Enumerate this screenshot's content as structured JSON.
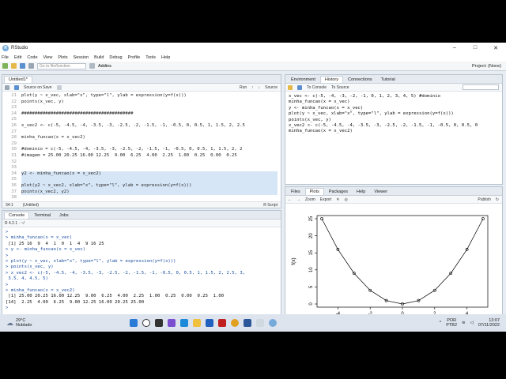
{
  "window": {
    "title": "RStudio",
    "app_icon": "R"
  },
  "menu": [
    "File",
    "Edit",
    "Code",
    "View",
    "Plots",
    "Session",
    "Build",
    "Debug",
    "Profile",
    "Tools",
    "Help"
  ],
  "toolbar": {
    "goto_placeholder": "Go to file/function",
    "addins": "Addins",
    "project": "Project: (None)"
  },
  "source": {
    "tab": "Untitled1*",
    "save_label": "Source on Save",
    "run_label": "Run",
    "source_label": "Source",
    "line_numbers": [
      "21",
      "22",
      "23",
      "24",
      "25",
      "26",
      "27",
      "28",
      "29",
      "30",
      "31",
      "32",
      "33",
      "34",
      "35",
      "36",
      "37",
      "38",
      "39",
      "40"
    ],
    "lines": [
      "plot(y ~ x_vec, xlab=\"x\", type=\"l\", ylab = expression(y=f(x)))",
      "points(x_vec, y)",
      "",
      "##########################################",
      "",
      "x_vec2 <- c(-5, -4.5, -4, -3.5, -3, -2.5, -2, -1.5, -1, -0.5, 0, 0.5, 1, 1.5, 2, 2.5",
      "",
      "minha_funcao(x = x_vec2)",
      "",
      "#dominio = c(-5, -4.5, -4, -3.5, -3, -2.5, -2, -1.5, -1, -0.5, 0, 0.5, 1, 1.5, 2, 2",
      "#imagem = 25.00 20.25 16.00 12.25  9.00  6.25  4.00  2.25  1.00  0.25  0.00  0.25",
      "",
      "",
      "y2 <- minha_funcao(x = x_vec2)",
      "",
      "plot(y2 ~ x_vec2, xlab=\"x\", type=\"l\", ylab = expression(y=f(x)))",
      "points(x_vec2, y2)",
      "",
      "##########################################",
      ""
    ],
    "status_pos": "34:1",
    "status_scope": "(Untitled)",
    "status_type": "R Script"
  },
  "console": {
    "tabs": [
      "Console",
      "Terminal",
      "Jobs"
    ],
    "path": "R 4.2.1 · ~/",
    "lines": [
      {
        "t": "cmd",
        "s": ">"
      },
      {
        "t": "cmd",
        "s": "> minha_funcao(x = x_vec)"
      },
      {
        "t": "out",
        "s": " [1] 25 16  9  4  1  0  1  4  9 16 25"
      },
      {
        "t": "cmd",
        "s": "> y <- minha_funcao(x = x_vec)"
      },
      {
        "t": "cmd",
        "s": ">"
      },
      {
        "t": "cmd",
        "s": "> plot(y ~ x_vec, xlab=\"x\", type=\"l\", ylab = expression(y=f(x)))"
      },
      {
        "t": "cmd",
        "s": "> points(x_vec, y)"
      },
      {
        "t": "cmd",
        "s": "> x_vec2 <- c(-5, -4.5, -4, -3.5, -3, -2.5, -2, -1.5, -1, -0.5, 0, 0.5, 1, 1.5, 2, 2.5, 3,"
      },
      {
        "t": "cmd",
        "s": " 3.5, 4, 4.5, 5)"
      },
      {
        "t": "cmd",
        "s": ">"
      },
      {
        "t": "cmd",
        "s": "> minha_funcao(x = x_vec2)"
      },
      {
        "t": "out",
        "s": " [1] 25.00 20.25 16.00 12.25  9.00  6.25  4.00  2.25  1.00  0.25  0.00  0.25  1.00"
      },
      {
        "t": "out",
        "s": "[14]  2.25  4.00  6.25  9.00 12.25 16.00 20.25 25.00"
      },
      {
        "t": "cmd",
        "s": ">"
      }
    ]
  },
  "env": {
    "tabs": [
      "Environment",
      "History",
      "Connections",
      "Tutorial"
    ],
    "to_console": "To Console",
    "to_source": "To Source",
    "lines": [
      "x_vec <- c(-5, -4, -3, -2, -1, 0, 1, 2, 3, 4, 5) #dominio",
      "minha_funcao(x = x_vec)",
      "y <- minha_funcao(x = x_vec)",
      "plot(y ~ x_vec, xlab=\"x\", type=\"l\", ylab = expression(y=f(x)))",
      "points(x_vec, y)",
      "x_vec2 <- c(-5, -4.5, -4, -3.5, -3, -2.5, -2, -1.5, -1, -0.5, 0, 0.5, 0",
      "minha_funcao(x = x_vec2)"
    ]
  },
  "files": {
    "tabs": [
      "Files",
      "Plots",
      "Packages",
      "Help",
      "Viewer"
    ],
    "zoom": "Zoom",
    "export": "Export",
    "publish": "Publish"
  },
  "chart_data": {
    "type": "line",
    "x": [
      -5,
      -4,
      -3,
      -2,
      -1,
      0,
      1,
      2,
      3,
      4,
      5
    ],
    "y": [
      25,
      16,
      9,
      4,
      1,
      0,
      1,
      4,
      9,
      16,
      25
    ],
    "xlabel": "x",
    "ylabel": "f(x)",
    "xticks": [
      "-4",
      "-2",
      "0",
      "2",
      "4"
    ],
    "yticks": [
      "0",
      "5",
      "10",
      "15",
      "20",
      "25"
    ],
    "xlim": [
      -5,
      5
    ],
    "ylim": [
      0,
      25
    ],
    "points": true
  },
  "taskbar": {
    "weather_temp": "29°C",
    "weather_desc": "Nublado",
    "lang": "POR",
    "lang2": "PTB2",
    "time": "13:07",
    "date": "07/11/2022"
  },
  "colors": {
    "accent": "#2a6ebb",
    "cmd": "#1d4fa0"
  }
}
